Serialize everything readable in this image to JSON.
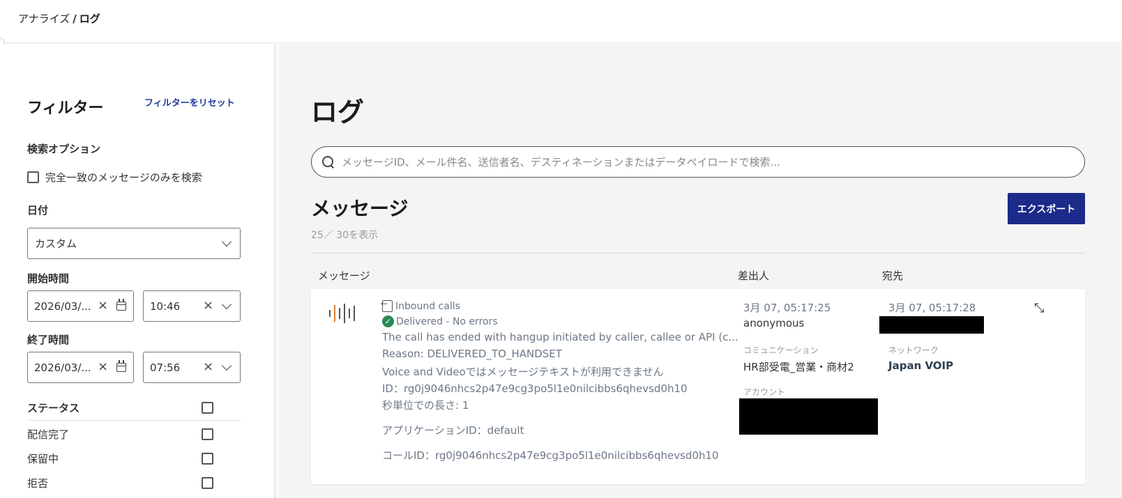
{
  "breadcrumb": {
    "parent": "アナライズ",
    "separator": "/",
    "current": "ログ"
  },
  "filter": {
    "title": "フィルター",
    "reset_label": "フィルターをリセット",
    "search_options_label": "検索オプション",
    "exact_match_label": "完全一致のメッセージのみを検索",
    "date_label": "日付",
    "date_value": "カスタム",
    "start_label": "開始時間",
    "start_date": "2026/03/...",
    "start_time": "10:46",
    "end_label": "終了時間",
    "end_date": "2026/03/...",
    "end_time": "07:56",
    "status_label": "ステータス",
    "statuses": [
      "配信完了",
      "保留中",
      "拒否"
    ]
  },
  "main": {
    "title": "ログ",
    "search_placeholder": "メッセージID、メール件名、送信者名、デスティネーションまたはデータペイロードで検索...",
    "messages_title": "メッセージ",
    "count_text": "25／ 30を表示",
    "export_label": "エクスポート",
    "columns": {
      "message": "メッセージ",
      "sender": "差出人",
      "destination": "宛先"
    }
  },
  "row": {
    "type": "Inbound calls",
    "status": "Delivered - No errors",
    "summary": "The call has ended with hangup initiated by caller, callee or API (c...",
    "reason": "Reason: DELIVERED_TO_HANDSET",
    "text_note": "Voice and Videoではメッセージテキストが利用できません",
    "id_line": "ID：rg0j9046nhcs2p47e9cg3po5l1e0nilcibbs6qhevsd0h10",
    "duration_line": "秒単位での長さ: 1",
    "app_id_line": "アプリケーションID：default",
    "call_id_line": "コールID：rg0j9046nhcs2p47e9cg3po5l1e0nilcibbs6qhevsd0h10",
    "sender_time": "3月 07, 05:17:25",
    "sender_name": "anonymous",
    "communication_label": "コミュニケーション",
    "communication_value": "HR部受電_営業・商材2",
    "account_label": "アカウント",
    "dest_time": "3月 07, 05:17:28",
    "network_label": "ネットワーク",
    "network_value": "Japan VOIP"
  },
  "icons": {
    "wave": "audio-wave-icon",
    "inbound": "inbound-call-icon",
    "delivered": "check-circle-icon",
    "collapse": "collapse-arrows-icon",
    "search": "search-icon",
    "calendar": "calendar-icon",
    "clear": "clear-x-icon",
    "chevron": "chevron-down-icon"
  },
  "colors": {
    "accent": "#1c2a8a",
    "link": "#1d3a9e",
    "success": "#2a8a55",
    "wave_highlight": "#e07a2e"
  }
}
